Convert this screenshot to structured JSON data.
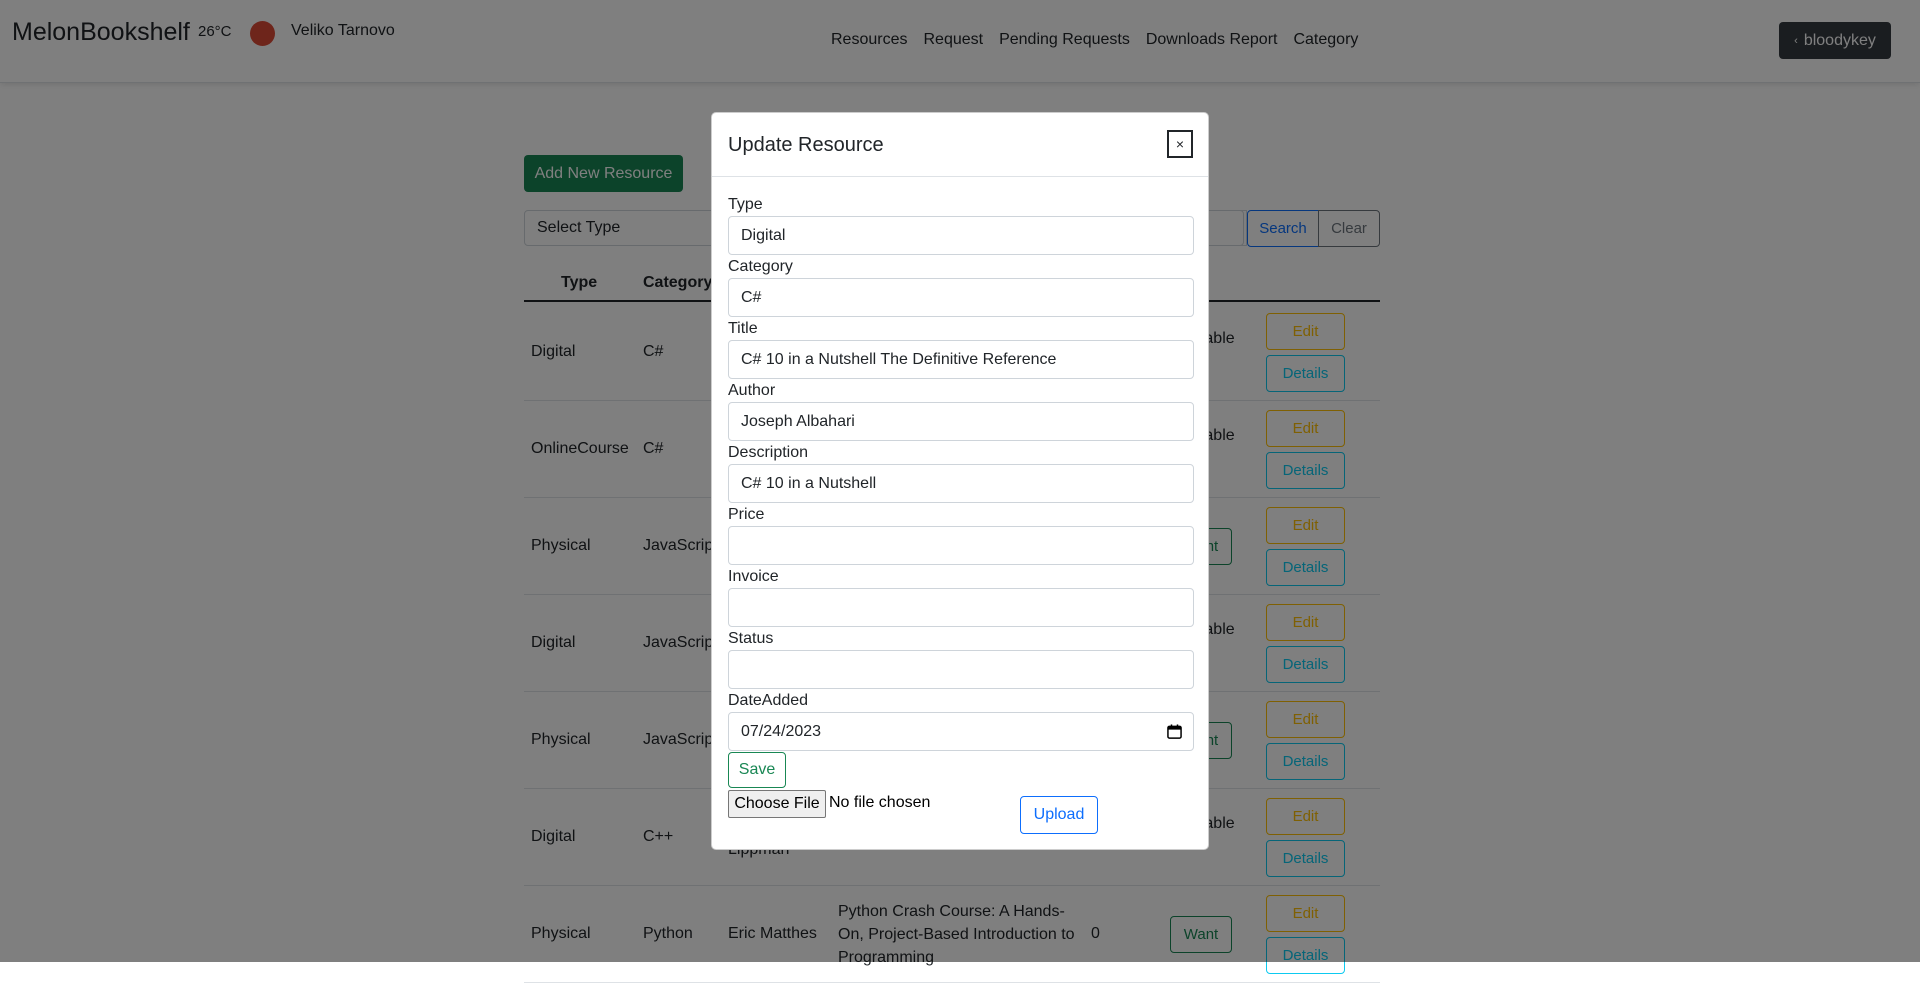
{
  "navbar": {
    "brand": "MelonBookshelf",
    "temperature": "26°C",
    "city": "Veliko Tarnovo",
    "weather_icon_color": "#dc4a36",
    "links": [
      "Resources",
      "Request",
      "Pending Requests",
      "Downloads Report",
      "Category"
    ],
    "user": "bloodykey"
  },
  "page": {
    "add_button": "Add New Resource",
    "type_filter_placeholder": "Select Type",
    "search_button": "Search",
    "clear_button": "Clear",
    "columns": {
      "type": "Type",
      "category": "Category"
    },
    "rows": [
      {
        "type": "Digital",
        "category": "C#",
        "author": "",
        "title": "",
        "price": "",
        "status": "Available",
        "action": "",
        "edit": "Edit",
        "details": "Details"
      },
      {
        "type": "OnlineCourse",
        "category": "C#",
        "author": "",
        "title": "",
        "price": "",
        "status": "Available",
        "action": "",
        "edit": "Edit",
        "details": "Details"
      },
      {
        "type": "Physical",
        "category": "JavaScript",
        "author": "",
        "title": "",
        "price": "",
        "status": "",
        "action": "Want",
        "edit": "Edit",
        "details": "Details"
      },
      {
        "type": "Digital",
        "category": "JavaScript",
        "author": "",
        "title": "",
        "price": "",
        "status": "Available",
        "action": "",
        "edit": "Edit",
        "details": "Details"
      },
      {
        "type": "Physical",
        "category": "JavaScript",
        "author": "",
        "title": "",
        "price": "",
        "status": "",
        "action": "Want",
        "edit": "Edit",
        "details": "Details"
      },
      {
        "type": "Digital",
        "category": "C++",
        "author": "Lippman",
        "title": "",
        "price": "",
        "status": "Available",
        "action": "",
        "edit": "Edit",
        "details": "Details"
      },
      {
        "type": "Physical",
        "category": "Python",
        "author": "Eric Matthes",
        "title": "Python Crash Course: A Hands-On, Project-Based Introduction to Programming",
        "price": "0",
        "status": "",
        "action": "Want",
        "edit": "Edit",
        "details": "Details"
      }
    ]
  },
  "modal": {
    "title": "Update Resource",
    "close": "×",
    "fields": [
      {
        "label": "Type",
        "value": "Digital"
      },
      {
        "label": "Category",
        "value": "C#"
      },
      {
        "label": "Title",
        "value": "C# 10 in a Nutshell The Definitive Reference"
      },
      {
        "label": "Author",
        "value": "Joseph Albahari"
      },
      {
        "label": "Description",
        "value": "C# 10 in a Nutshell"
      },
      {
        "label": "Price",
        "value": ""
      },
      {
        "label": "Invoice",
        "value": ""
      },
      {
        "label": "Status",
        "value": ""
      },
      {
        "label": "DateAdded",
        "value": "07/24/2023"
      }
    ],
    "save_button": "Save",
    "choose_file_button": "Choose File",
    "no_file_text": "No file chosen",
    "upload_button": "Upload"
  }
}
